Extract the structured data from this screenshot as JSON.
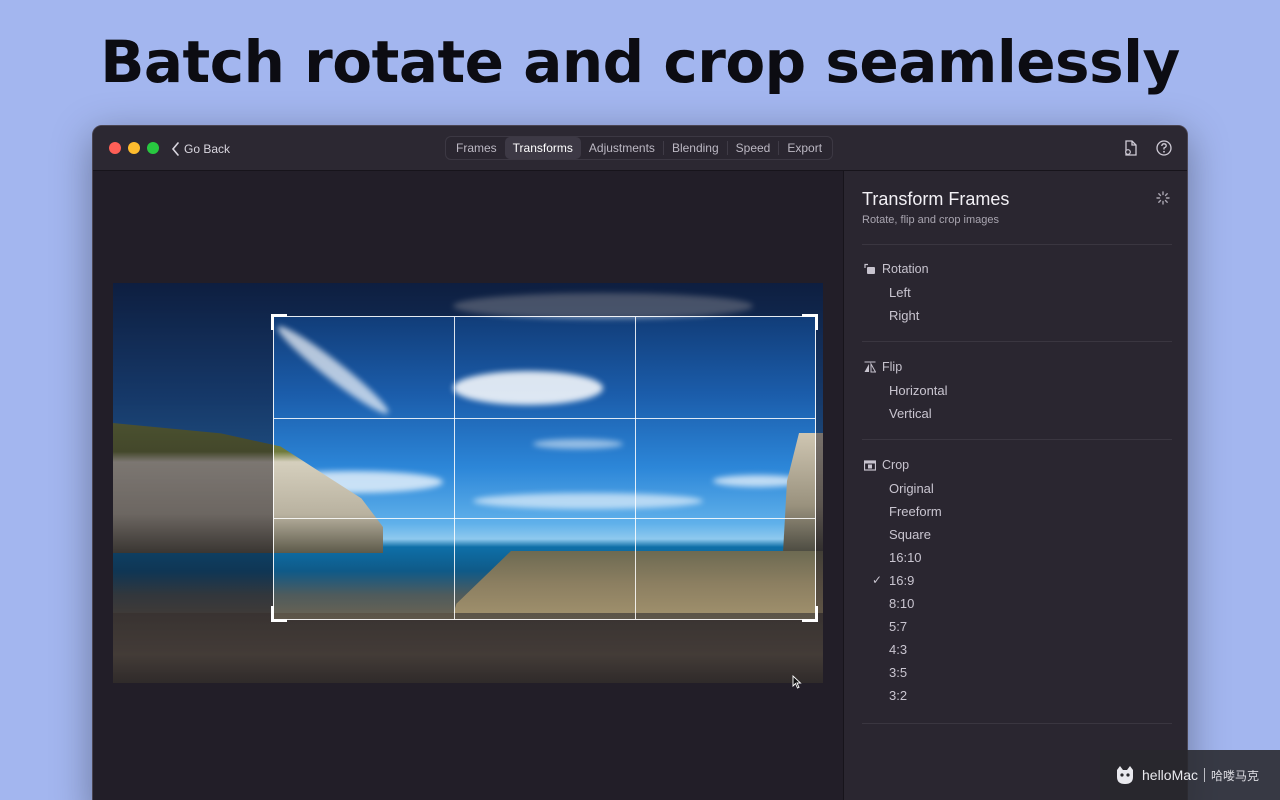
{
  "headline": "Batch rotate and crop seamlessly",
  "toolbar": {
    "go_back": "Go Back",
    "tabs": [
      {
        "label": "Frames",
        "active": false
      },
      {
        "label": "Transforms",
        "active": true
      },
      {
        "label": "Adjustments",
        "active": false
      },
      {
        "label": "Blending",
        "active": false
      },
      {
        "label": "Speed",
        "active": false
      },
      {
        "label": "Export",
        "active": false
      }
    ]
  },
  "sidebar": {
    "title": "Transform Frames",
    "subtitle": "Rotate, flip and crop images",
    "rotation": {
      "heading": "Rotation",
      "options": [
        "Left",
        "Right"
      ]
    },
    "flip": {
      "heading": "Flip",
      "options": [
        "Horizontal",
        "Vertical"
      ]
    },
    "crop": {
      "heading": "Crop",
      "options": [
        "Original",
        "Freeform",
        "Square",
        "16:10",
        "16:9",
        "8:10",
        "5:7",
        "4:3",
        "3:5",
        "3:2"
      ],
      "selected": "16:9",
      "check_mark": "✓"
    }
  },
  "watermark": {
    "brand": "helloMac",
    "cn": "哈喽马克"
  },
  "colors": {
    "background": "#a3b6ef",
    "window": "#221e28",
    "sidebar": "#2a2630",
    "accent_active_tab": "#3d3945"
  }
}
